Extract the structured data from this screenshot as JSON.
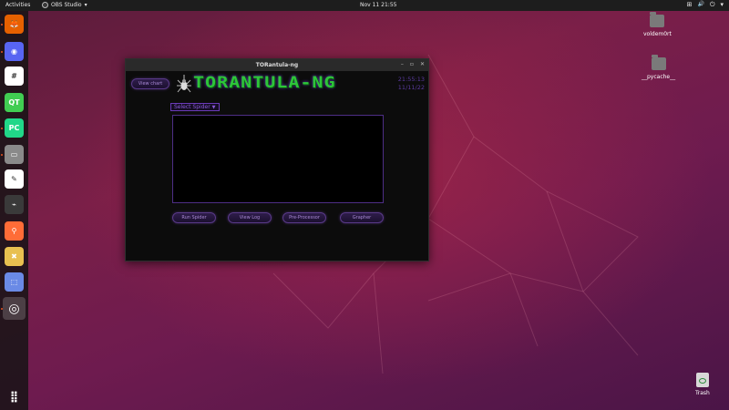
{
  "topbar": {
    "activities": "Activities",
    "app_name": "OBS Studio",
    "app_arrow": "▾",
    "clock": "Nov 11  21:55",
    "tray_network": "⊞",
    "tray_volume": "🔊",
    "tray_power": "⏻",
    "tray_arrow": "▾"
  },
  "dock": {
    "items": [
      {
        "name": "firefox-icon",
        "glyph": "🦊",
        "color": "#e66000"
      },
      {
        "name": "discord-icon",
        "glyph": "◉",
        "color": "#5865f2"
      },
      {
        "name": "slack-icon",
        "glyph": "#",
        "color": "#ffffff"
      },
      {
        "name": "qt-creator-icon",
        "glyph": "QT",
        "color": "#41cd52"
      },
      {
        "name": "pycharm-icon",
        "glyph": "PC",
        "color": "#21d789"
      },
      {
        "name": "files-icon",
        "glyph": "▭",
        "color": "#8a8a8a"
      },
      {
        "name": "text-editor-icon",
        "glyph": "✎",
        "color": "#ffffff"
      },
      {
        "name": "system-monitor-icon",
        "glyph": "⌁",
        "color": "#3a3a3a"
      },
      {
        "name": "postman-icon",
        "glyph": "⚲",
        "color": "#ff6c37"
      },
      {
        "name": "cmake-icon",
        "glyph": "✖",
        "color": "#e8c050"
      },
      {
        "name": "screenshot-icon",
        "glyph": "⬚",
        "color": "#6a8ae6"
      },
      {
        "name": "obs-icon",
        "glyph": "◎",
        "color": "#2b2b2b"
      }
    ],
    "apps_grid": "⣿"
  },
  "desktop": {
    "folders": [
      {
        "label": "voldem0rt"
      },
      {
        "label": "__pycache__"
      }
    ],
    "trash_label": "Trash"
  },
  "window": {
    "title": "TORantula-ng",
    "minimize": "–",
    "maximize": "▫",
    "close": "✕",
    "view_chart": "View chart",
    "logo": "TORANTULA-NG",
    "time": "21:55:13",
    "date": "11/11/22",
    "select_spider": "Select Spider",
    "select_arrow": "▼",
    "buttons": {
      "run_spider": "Run Spider",
      "view_log": "View Log",
      "pre_processor": "Pre-Processor",
      "grapher": "Grapher"
    }
  }
}
